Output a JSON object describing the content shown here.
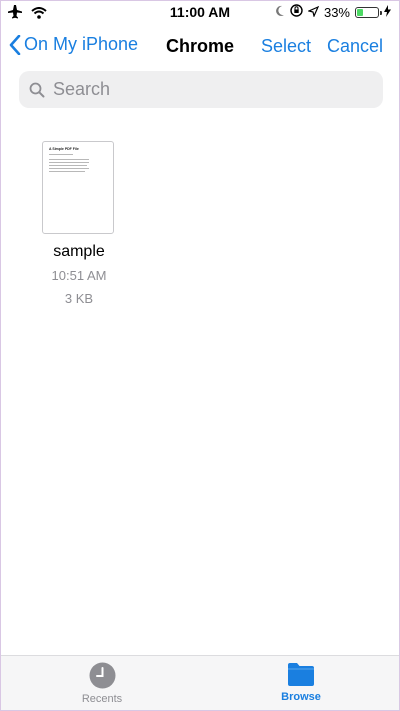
{
  "status_bar": {
    "time": "11:00 AM",
    "battery_percent": "33%",
    "battery_level": 0.33,
    "icons_left": [
      "airplane-icon",
      "wifi-icon"
    ],
    "icons_right": [
      "moon-icon",
      "orientation-lock-icon",
      "location-icon",
      "battery-icon",
      "charging-icon"
    ]
  },
  "nav": {
    "back_label": "On My iPhone",
    "title": "Chrome",
    "select_label": "Select",
    "cancel_label": "Cancel"
  },
  "search": {
    "placeholder": "Search",
    "value": ""
  },
  "files": [
    {
      "name": "sample",
      "time": "10:51 AM",
      "size": "3 KB",
      "thumbnail_heading": "A Simple PDF File"
    }
  ],
  "tabs": [
    {
      "label": "Recents",
      "icon": "clock-icon",
      "active": false
    },
    {
      "label": "Browse",
      "icon": "folder-icon",
      "active": true
    }
  ],
  "colors": {
    "accent": "#1a7fe0",
    "inactive": "#8e8e93",
    "battery": "#4cd964"
  }
}
